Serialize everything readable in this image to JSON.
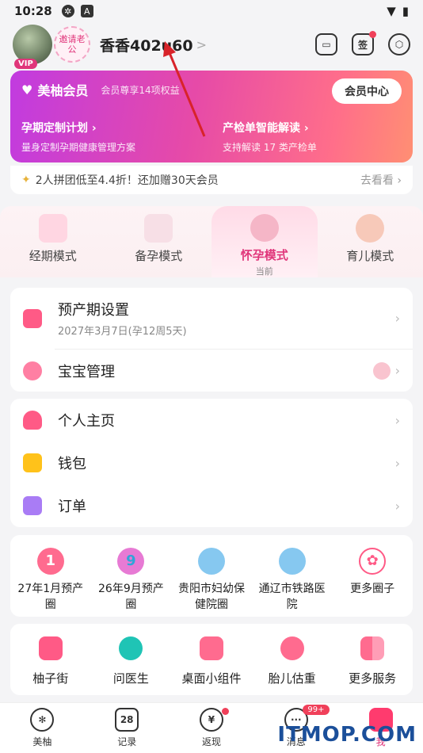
{
  "status": {
    "time": "10:28"
  },
  "header": {
    "avatar_badge": "VIP",
    "invite_label": "邀请老公",
    "username": "香香402u60",
    "chevron": ">",
    "icons": [
      "scan-icon",
      "gift-icon",
      "settings-icon"
    ],
    "gift_label": "签"
  },
  "vip": {
    "title": "美柚会员",
    "subtitle": "会员尊享14项权益",
    "center_button": "会员中心",
    "features": [
      {
        "title": "孕期定制计划",
        "desc": "量身定制孕期健康管理方案"
      },
      {
        "title": "产检单智能解读",
        "desc": "支持解读 17 类产检单"
      }
    ]
  },
  "promo": {
    "text": "2人拼团低至4.4折！还加赠30天会员",
    "action": "去看看"
  },
  "modes": [
    {
      "label": "经期模式",
      "sub": ""
    },
    {
      "label": "备孕模式",
      "sub": ""
    },
    {
      "label": "怀孕模式",
      "sub": "当前"
    },
    {
      "label": "育儿模式",
      "sub": ""
    }
  ],
  "pregnancy": {
    "due_title": "预产期设置",
    "due_value": "2027年3月7日(孕12周5天)",
    "baby_title": "宝宝管理"
  },
  "menu": [
    {
      "label": "个人主页",
      "icon": "person-icon"
    },
    {
      "label": "钱包",
      "icon": "wallet-icon"
    },
    {
      "label": "订单",
      "icon": "order-icon"
    }
  ],
  "circles": [
    {
      "line1": "27年1月预产",
      "line2": "圈",
      "glyph": "1"
    },
    {
      "line1": "26年9月预产",
      "line2": "圈",
      "glyph": "9"
    },
    {
      "line1": "贵阳市妇幼保",
      "line2": "健院圈",
      "glyph": ""
    },
    {
      "line1": "通辽市铁路医",
      "line2": "院",
      "glyph": ""
    },
    {
      "line1": "更多圈子",
      "line2": "",
      "glyph": ""
    }
  ],
  "services": [
    {
      "label": "柚子街"
    },
    {
      "label": "问医生"
    },
    {
      "label": "桌面小组件"
    },
    {
      "label": "胎儿估重"
    },
    {
      "label": "更多服务"
    }
  ],
  "tabs": [
    {
      "label": "美柚"
    },
    {
      "label": "记录",
      "glyph": "28"
    },
    {
      "label": "返现",
      "glyph": "¥"
    },
    {
      "label": "消息",
      "badge": "99+"
    },
    {
      "label": "我"
    }
  ],
  "watermark": "ITMOP.COM",
  "colors": {
    "brand": "#e0357a",
    "accent": "#ff3b6e",
    "vip_start": "#c13be0",
    "vip_end": "#ff8f73"
  }
}
